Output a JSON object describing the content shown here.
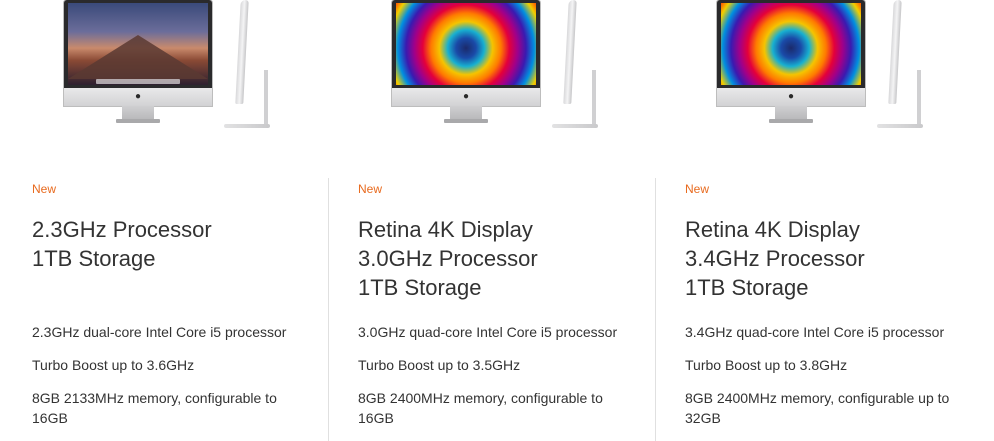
{
  "products": [
    {
      "screen": "sierra-wallpaper",
      "badge": "New",
      "title_lines": [
        "2.3GHz Processor",
        "1TB Storage"
      ],
      "specs": [
        "2.3GHz dual-core Intel Core i5 processor",
        "Turbo Boost up to 3.6GHz",
        "8GB 2133MHz memory, configurable to 16GB"
      ]
    },
    {
      "screen": "color-swirl-wallpaper",
      "badge": "New",
      "title_lines": [
        "Retina 4K Display",
        "3.0GHz Processor",
        "1TB Storage"
      ],
      "specs": [
        "3.0GHz quad-core Intel Core i5 processor",
        "Turbo Boost up to 3.5GHz",
        "8GB 2400MHz memory, configurable to 16GB"
      ]
    },
    {
      "screen": "color-swirl-wallpaper",
      "badge": "New",
      "title_lines": [
        "Retina 4K Display",
        "3.4GHz Processor",
        "1TB Storage"
      ],
      "specs": [
        "3.4GHz quad-core Intel Core i5 processor",
        "Turbo Boost up to 3.8GHz",
        "8GB 2400MHz memory, configurable up to 32GB"
      ]
    }
  ],
  "colors": {
    "badge": "#e86a1e",
    "text": "#333333",
    "divider": "#e0e0e0"
  },
  "icons": {
    "apple_logo": "apple-logo-icon"
  }
}
